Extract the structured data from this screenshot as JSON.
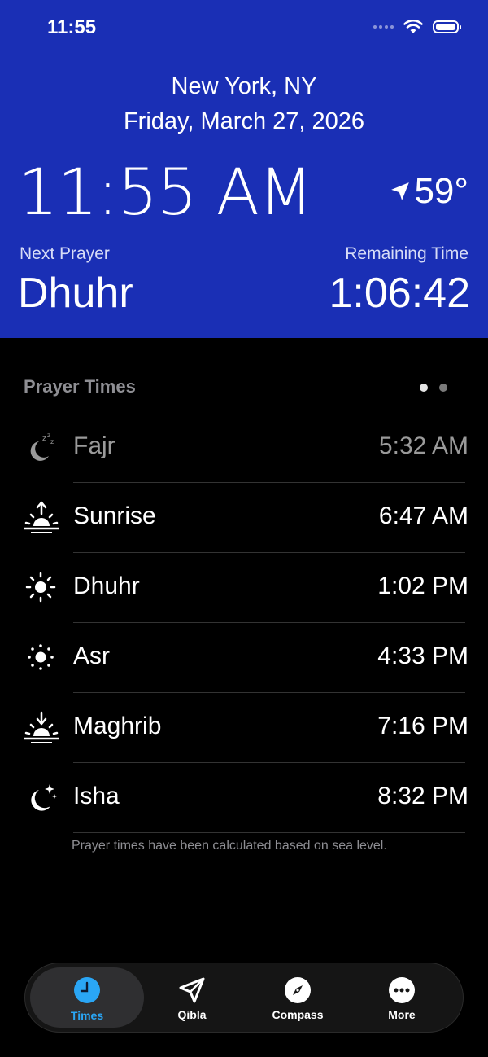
{
  "status_bar": {
    "time": "11:55"
  },
  "header": {
    "city": "New York, NY",
    "date": "Friday, March 27, 2026",
    "clock": "11:55 AM",
    "temperature": "59°",
    "next_prayer_label": "Next Prayer",
    "next_prayer": "Dhuhr",
    "remaining_label": "Remaining Time",
    "remaining_time": "1:06:42"
  },
  "prayer_times": {
    "title": "Prayer Times",
    "items": [
      {
        "name": "Fajr",
        "time": "5:32 AM",
        "icon": "moon-sleep-icon",
        "dimmed": true
      },
      {
        "name": "Sunrise",
        "time": "6:47 AM",
        "icon": "sunrise-icon",
        "dimmed": false
      },
      {
        "name": "Dhuhr",
        "time": "1:02 PM",
        "icon": "sun-icon",
        "dimmed": false
      },
      {
        "name": "Asr",
        "time": "4:33 PM",
        "icon": "sun-small-icon",
        "dimmed": false
      },
      {
        "name": "Maghrib",
        "time": "7:16 PM",
        "icon": "sunset-icon",
        "dimmed": false
      },
      {
        "name": "Isha",
        "time": "8:32 PM",
        "icon": "moon-stars-icon",
        "dimmed": false
      }
    ],
    "footnote": "Prayer times have been calculated based on sea level."
  },
  "tabs": [
    {
      "label": "Times",
      "icon": "clock-icon",
      "active": true
    },
    {
      "label": "Qibla",
      "icon": "location-arrow-icon",
      "active": false
    },
    {
      "label": "Compass",
      "icon": "compass-icon",
      "active": false
    },
    {
      "label": "More",
      "icon": "more-icon",
      "active": false
    }
  ],
  "colors": {
    "header_bg": "#1a2fb5",
    "accent": "#2aa6f5",
    "dimmed_text": "#9a9a9a"
  }
}
